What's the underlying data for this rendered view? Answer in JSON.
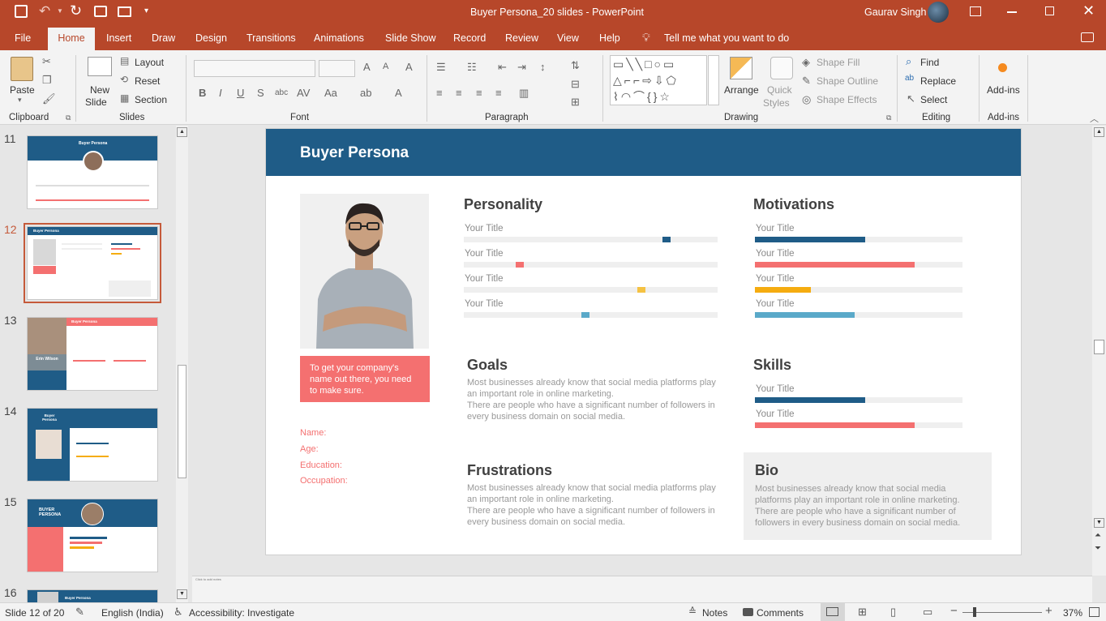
{
  "window": {
    "title": "Buyer Persona_20 slides  -  PowerPoint",
    "user": "Gaurav Singh"
  },
  "tabs": [
    "File",
    "Home",
    "Insert",
    "Draw",
    "Design",
    "Transitions",
    "Animations",
    "Slide Show",
    "Record",
    "Review",
    "View",
    "Help"
  ],
  "tell_me": "Tell me what you want to do",
  "ribbon": {
    "clipboard": {
      "paste": "Paste",
      "label": "Clipboard"
    },
    "slides": {
      "new_slide_1": "New",
      "new_slide_2": "Slide",
      "layout": "Layout",
      "reset": "Reset",
      "section": "Section",
      "label": "Slides"
    },
    "font": {
      "label": "Font"
    },
    "paragraph": {
      "label": "Paragraph"
    },
    "drawing": {
      "arrange": "Arrange",
      "quick_styles_1": "Quick",
      "quick_styles_2": "Styles",
      "shape_fill": "Shape Fill",
      "shape_outline": "Shape Outline",
      "shape_effects": "Shape Effects",
      "label": "Drawing"
    },
    "editing": {
      "find": "Find",
      "replace": "Replace",
      "select": "Select",
      "label": "Editing"
    },
    "addins": {
      "button": "Add-ins",
      "label": "Add-ins"
    }
  },
  "thumbnails": [
    {
      "num": "11",
      "title": "Buyer Persona"
    },
    {
      "num": "12",
      "title": "Buyer Persona"
    },
    {
      "num": "13",
      "title": "Buyer Persona",
      "name": "Erin Wilson"
    },
    {
      "num": "14",
      "title": "Buyer Persona"
    },
    {
      "num": "15",
      "title": "BUYER PERSONA"
    },
    {
      "num": "16",
      "title": "Buyer Persona"
    }
  ],
  "slide": {
    "title": "Buyer Persona",
    "quote": "To get your company's name out there, you need to make sure.",
    "fields": [
      "Name:",
      "Age:",
      "Education:",
      "Occupation:"
    ],
    "personality": {
      "heading": "Personality",
      "items": [
        {
          "label": "Your Title",
          "position": 0.8,
          "color": "#1f5c87"
        },
        {
          "label": "Your Title",
          "position": 0.22,
          "color": "#f47070"
        },
        {
          "label": "Your Title",
          "position": 0.7,
          "color": "#f5c242"
        },
        {
          "label": "Your Title",
          "position": 0.48,
          "color": "#5aa9c9"
        }
      ]
    },
    "motivations": {
      "heading": "Motivations",
      "items": [
        {
          "label": "Your Title",
          "value": 0.53,
          "color": "#1f5c87"
        },
        {
          "label": "Your Title",
          "value": 0.77,
          "color": "#f47070"
        },
        {
          "label": "Your Title",
          "value": 0.27,
          "color": "#f5ac10"
        },
        {
          "label": "Your Title",
          "value": 0.48,
          "color": "#5aa9c9"
        }
      ]
    },
    "goals": {
      "heading": "Goals",
      "text1": "Most businesses already know that social media platforms play an important role in online marketing.",
      "text2": "There are people who have a significant number of followers in every business domain on social media."
    },
    "skills": {
      "heading": "Skills",
      "items": [
        {
          "label": "Your Title",
          "value": 0.53,
          "color": "#1f5c87"
        },
        {
          "label": "Your Title",
          "value": 0.77,
          "color": "#f47070"
        }
      ]
    },
    "frustrations": {
      "heading": "Frustrations",
      "text1": "Most businesses already know that social media platforms play an important role in online marketing.",
      "text2": "There are people who have a significant number of followers in every business domain on social media."
    },
    "bio": {
      "heading": "Bio",
      "text": "Most businesses already know that social media platforms play an important role in online marketing. There are people who have a significant number of followers in every business domain on social media."
    }
  },
  "notes_placeholder": "Click to add notes",
  "status": {
    "slide": "Slide 12 of 20",
    "language": "English (India)",
    "accessibility": "Accessibility: Investigate",
    "notes": "Notes",
    "comments": "Comments",
    "zoom": "37%"
  },
  "colors": {
    "accent": "#b7472a",
    "slide_header": "#1f5c87",
    "coral": "#f47070"
  }
}
